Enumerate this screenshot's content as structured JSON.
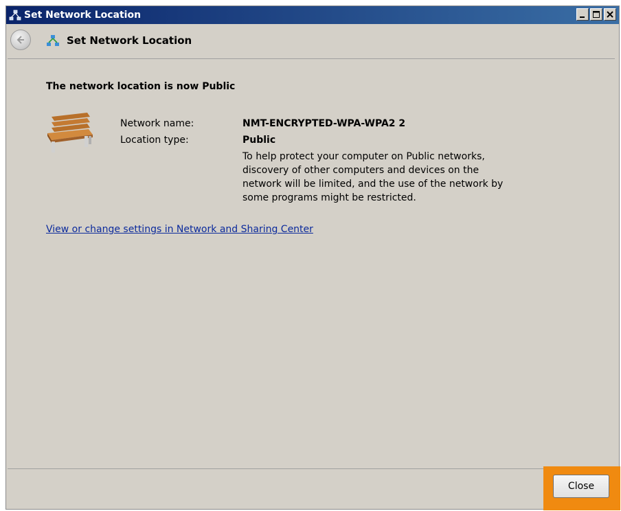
{
  "window": {
    "title": "Set Network Location",
    "controls": [
      "minimize-icon",
      "maximize-icon",
      "close-icon"
    ]
  },
  "header": {
    "title": "Set Network Location"
  },
  "main": {
    "heading": "The network location is now Public",
    "network_name_label": "Network name:",
    "network_name_value": "NMT-ENCRYPTED-WPA-WPA2  2",
    "location_type_label": "Location type:",
    "location_type_value": "Public",
    "description_lines": [
      "To help protect your computer on Public networks,",
      "discovery of other computers and devices on the",
      "network will be limited, and the use of the network by",
      "some programs might be restricted."
    ],
    "link_text": "View or change settings in Network and Sharing Center"
  },
  "footer": {
    "close_label": "Close"
  },
  "colors": {
    "titlebar_start": "#0a246a",
    "titlebar_end": "#3a6ea5",
    "window_bg": "#d4d0c8",
    "link": "#0b2a9c",
    "highlight": "#f08a10"
  }
}
